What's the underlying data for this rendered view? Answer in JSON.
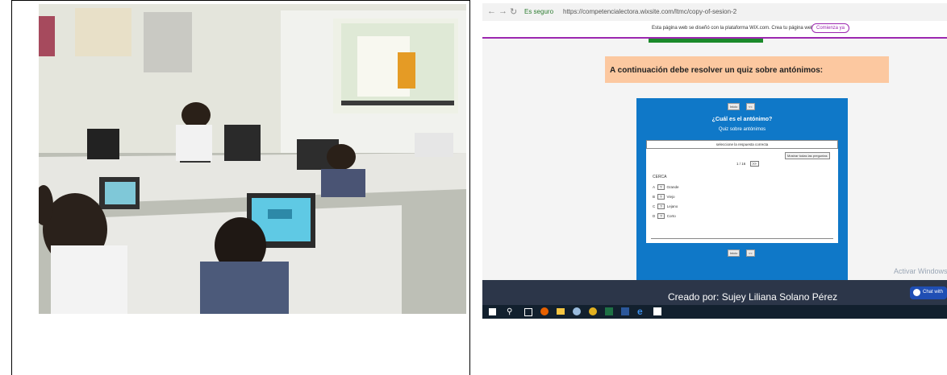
{
  "screenshot": {
    "browser": {
      "secure_label": "Es seguro",
      "url": "https://competencialectora.wixsite.com/ltmc/copy-of-sesion-2"
    },
    "wix_banner": {
      "message": "Esta página web se diseñó con la plataforma WiX.com. Crea tu página web hoy.",
      "button": "Comienza ya"
    },
    "instruction": "A continuación debe resolver un quiz sobre antónimos:",
    "quiz": {
      "top_buttons": [
        "Inicio",
        "<<"
      ],
      "title": "¿Cuál es el antónimo?",
      "subtitle": "Quiz sobre antónimos",
      "prompt": "seleccione la respuesta correcta",
      "show_all": "Mostrar todas las preguntas",
      "progress": "1 / 16",
      "next_button": ">>",
      "word": "CERCA",
      "options": [
        {
          "letter": "A",
          "text": "Grande"
        },
        {
          "letter": "B",
          "text": "Viejo"
        },
        {
          "letter": "C",
          "text": "Lejano"
        },
        {
          "letter": "D",
          "text": "Corto"
        }
      ],
      "bottom_buttons": [
        "Inicio",
        "<<"
      ]
    },
    "footer_credit": "Creado por: Sujey Liliana Solano Pérez",
    "watermark": "Activar Windows",
    "chat_label": "Chat with"
  },
  "colors": {
    "quiz_bg": "#0f78c8",
    "instruction_bg": "#fcc8a0",
    "wix_accent": "#9c27b0",
    "green_bar": "#1b8a2a",
    "footer_bg": "#2c3649",
    "taskbar_bg": "#12202e"
  }
}
